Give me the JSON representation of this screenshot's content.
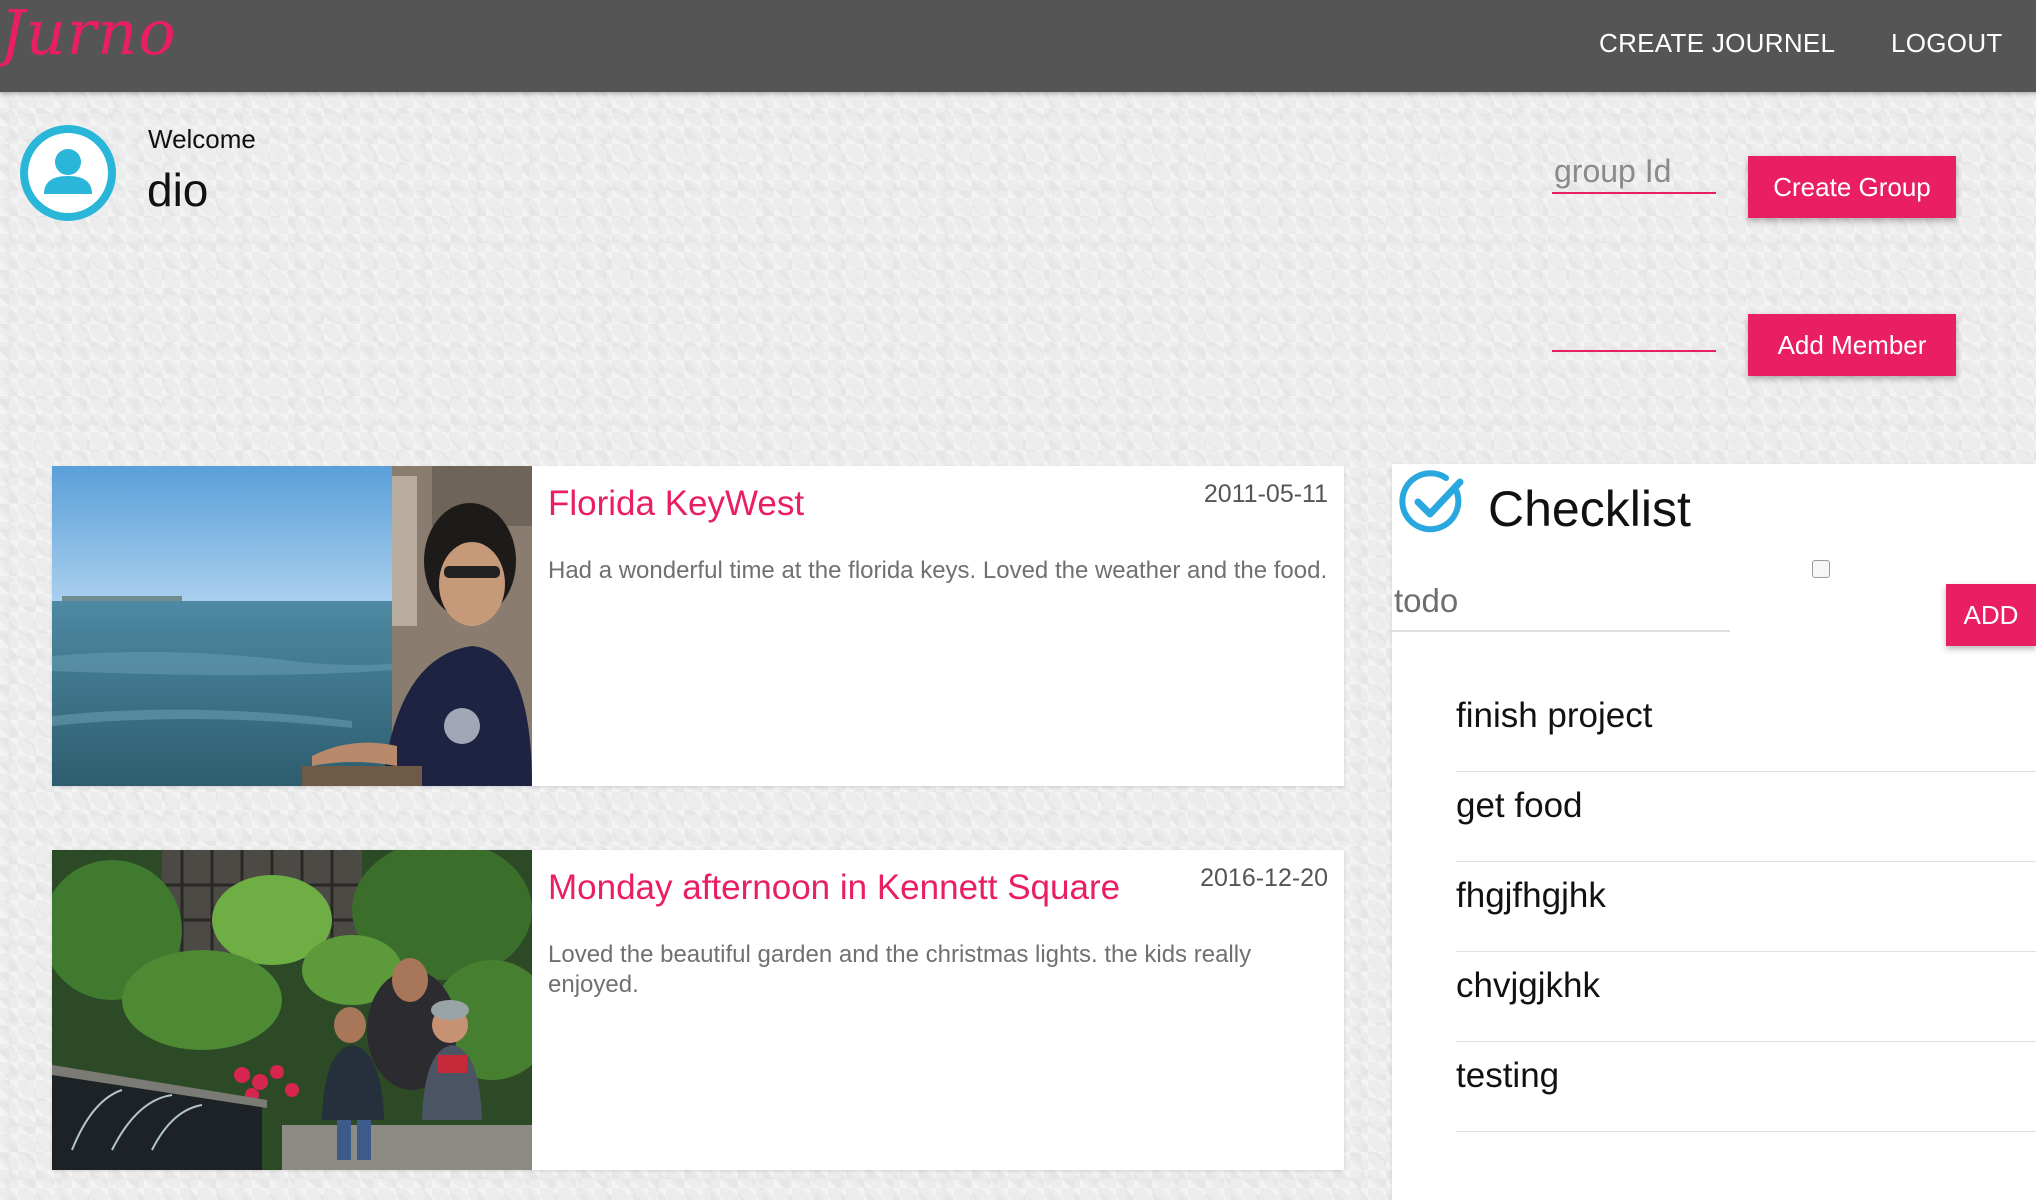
{
  "navbar": {
    "brand": "Jurno",
    "create_journel": "CREATE JOURNEL",
    "logout": "LOGOUT"
  },
  "welcome": {
    "label": "Welcome",
    "username": "dio",
    "avatar_icon": "user-avatar-icon"
  },
  "group": {
    "group_id_placeholder": "group Id",
    "group_id_value": "",
    "create_group_label": "Create Group",
    "member_value": "",
    "add_member_label": "Add Member"
  },
  "journals": [
    {
      "title": "Florida KeyWest",
      "date": "2011-05-11",
      "body": "Had a wonderful time at the florida keys. Loved the weather and the food."
    },
    {
      "title": "Monday afternoon in Kennett Square",
      "date": "2016-12-20",
      "body": "Loved the beautiful garden and the christmas lights. the kids really enjoyed."
    }
  ],
  "checklist": {
    "title": "Checklist",
    "icon": "check-circle-icon",
    "todo_placeholder": "todo",
    "add_label": "ADD",
    "items": [
      "finish project",
      "get food",
      "fhgjfhgjhk",
      "chvjgjkhk",
      "testing"
    ]
  },
  "colors": {
    "accent": "#e91e63",
    "navbar": "#555555",
    "icon_blue": "#29b6d9"
  }
}
